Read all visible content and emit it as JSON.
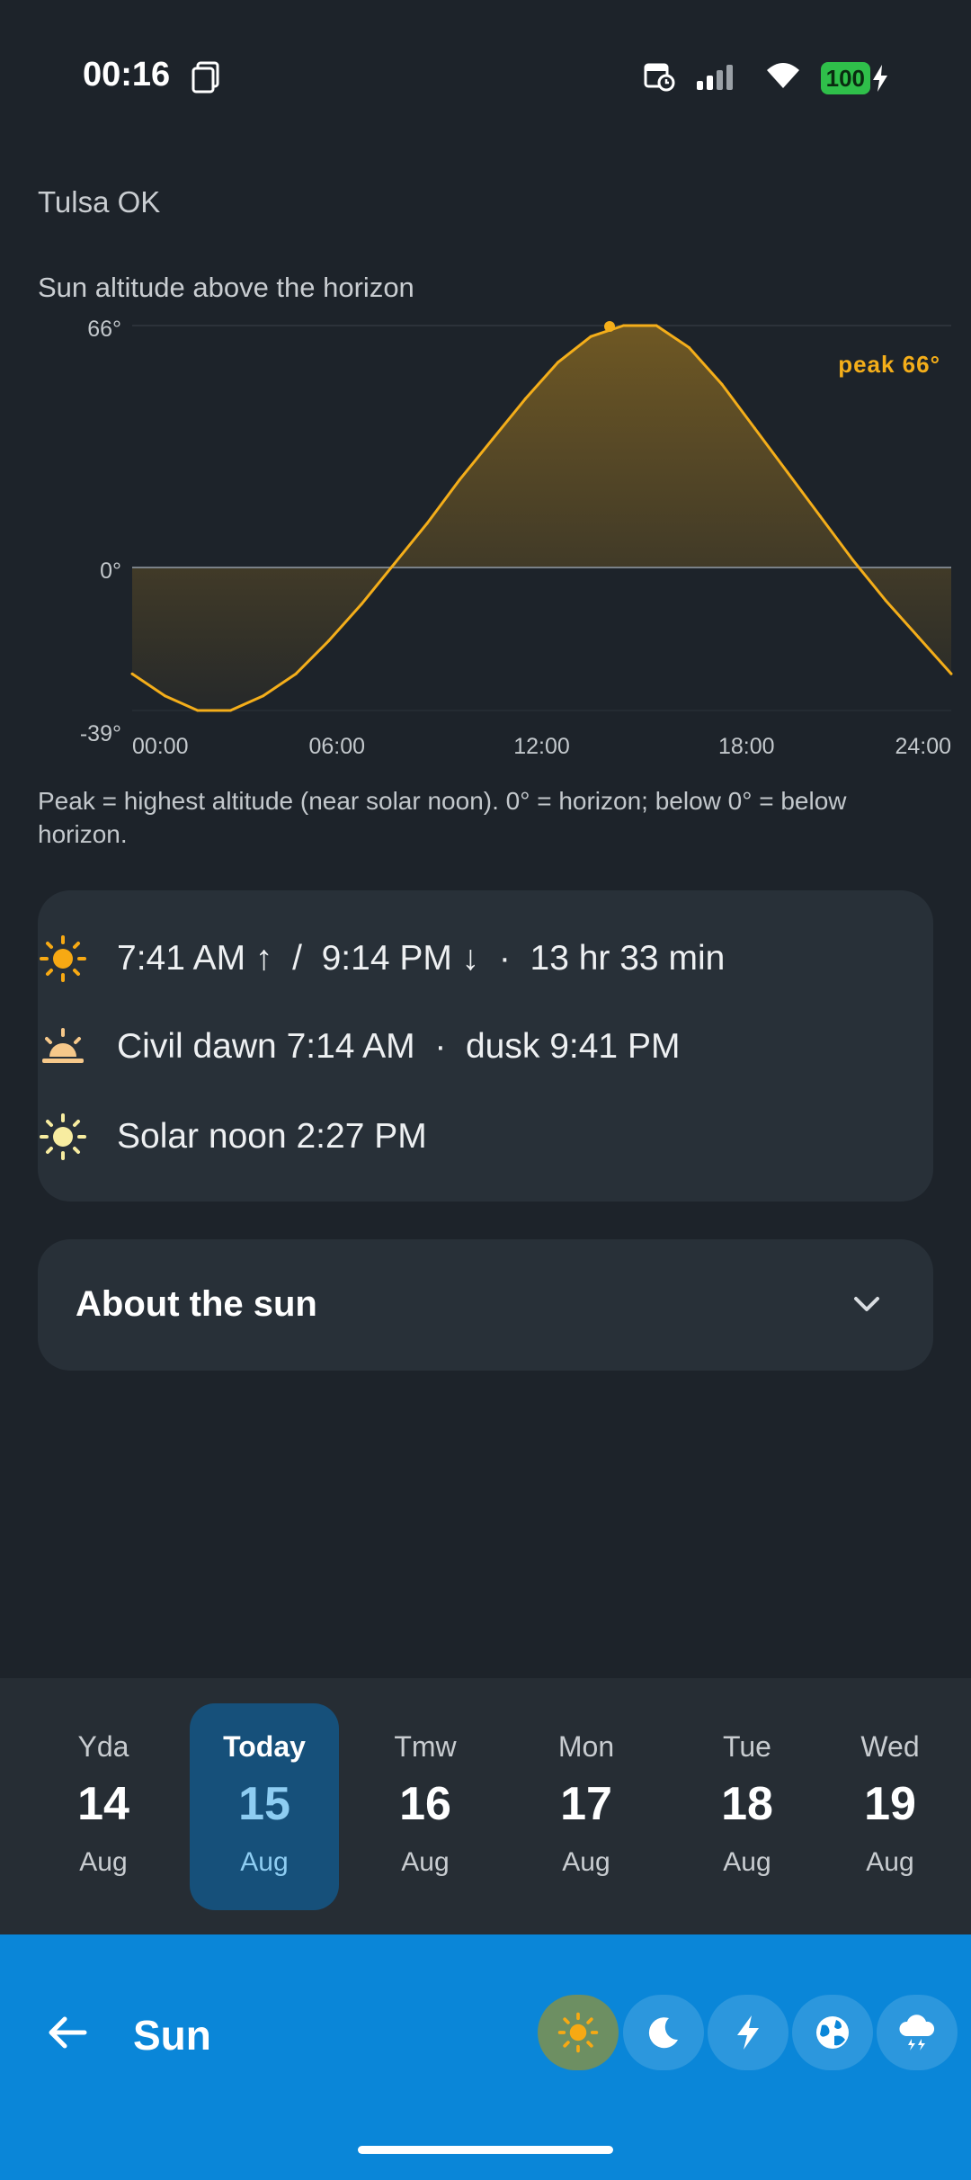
{
  "status": {
    "time": "00:16",
    "battery": "100",
    "icons": [
      "screenshot-icon",
      "calendar-clock-icon",
      "signal-icon",
      "wifi-icon",
      "battery-icon",
      "charging-icon"
    ]
  },
  "location": "Tulsa OK",
  "chart": {
    "title": "Sun altitude above the horizon",
    "peak_label": "peak 66°",
    "note": "Peak = highest altitude (near solar noon). 0° = horizon; below 0° = below horizon."
  },
  "chart_data": {
    "type": "area",
    "title": "Sun altitude above the horizon",
    "xlabel": "",
    "ylabel": "",
    "x_ticks": [
      "00:00",
      "06:00",
      "12:00",
      "18:00",
      "24:00"
    ],
    "y_ticks": [
      "66°",
      "0°",
      "-39°"
    ],
    "xlim": [
      0,
      24
    ],
    "ylim": [
      -39,
      66
    ],
    "grid": false,
    "peak": {
      "x": 15,
      "y": 66
    },
    "x": [
      0,
      1,
      2,
      3,
      4,
      5,
      6,
      7,
      8,
      9,
      10,
      11,
      12,
      13,
      14,
      15,
      16,
      17,
      18,
      19,
      20,
      21,
      22,
      23,
      24
    ],
    "values": [
      -29,
      -35,
      -39,
      -39,
      -35,
      -29,
      -20,
      -10,
      1,
      12,
      24,
      35,
      46,
      56,
      63,
      66,
      66,
      60,
      50,
      38,
      26,
      14,
      2,
      -9,
      -19,
      -29
    ]
  },
  "times": {
    "sunrise_sunset": "7:41 AM ↑  /  9:14 PM ↓  ·  13 hr 33 min",
    "civil": "Civil dawn 7:14 AM  ·  dusk 9:41 PM",
    "solar_noon": "Solar noon 2:27 PM"
  },
  "about": {
    "title": "About the sun"
  },
  "days": [
    {
      "name": "Yda",
      "num": "14",
      "month": "Aug"
    },
    {
      "name": "Today",
      "num": "15",
      "month": "Aug"
    },
    {
      "name": "Tmw",
      "num": "16",
      "month": "Aug"
    },
    {
      "name": "Mon",
      "num": "17",
      "month": "Aug"
    },
    {
      "name": "Tue",
      "num": "18",
      "month": "Aug"
    },
    {
      "name": "Wed",
      "num": "19",
      "month": "Aug"
    }
  ],
  "bottom": {
    "title": "Sun",
    "modes": [
      "sun-icon",
      "moon-icon",
      "lightning-icon",
      "globe-icon",
      "storm-cloud-icon"
    ]
  },
  "colors": {
    "background": "#1d232a",
    "card": "#283038",
    "accent": "#f4ae1a",
    "selected_day": "#16507a",
    "bottom_bar": "#0a86d8"
  }
}
